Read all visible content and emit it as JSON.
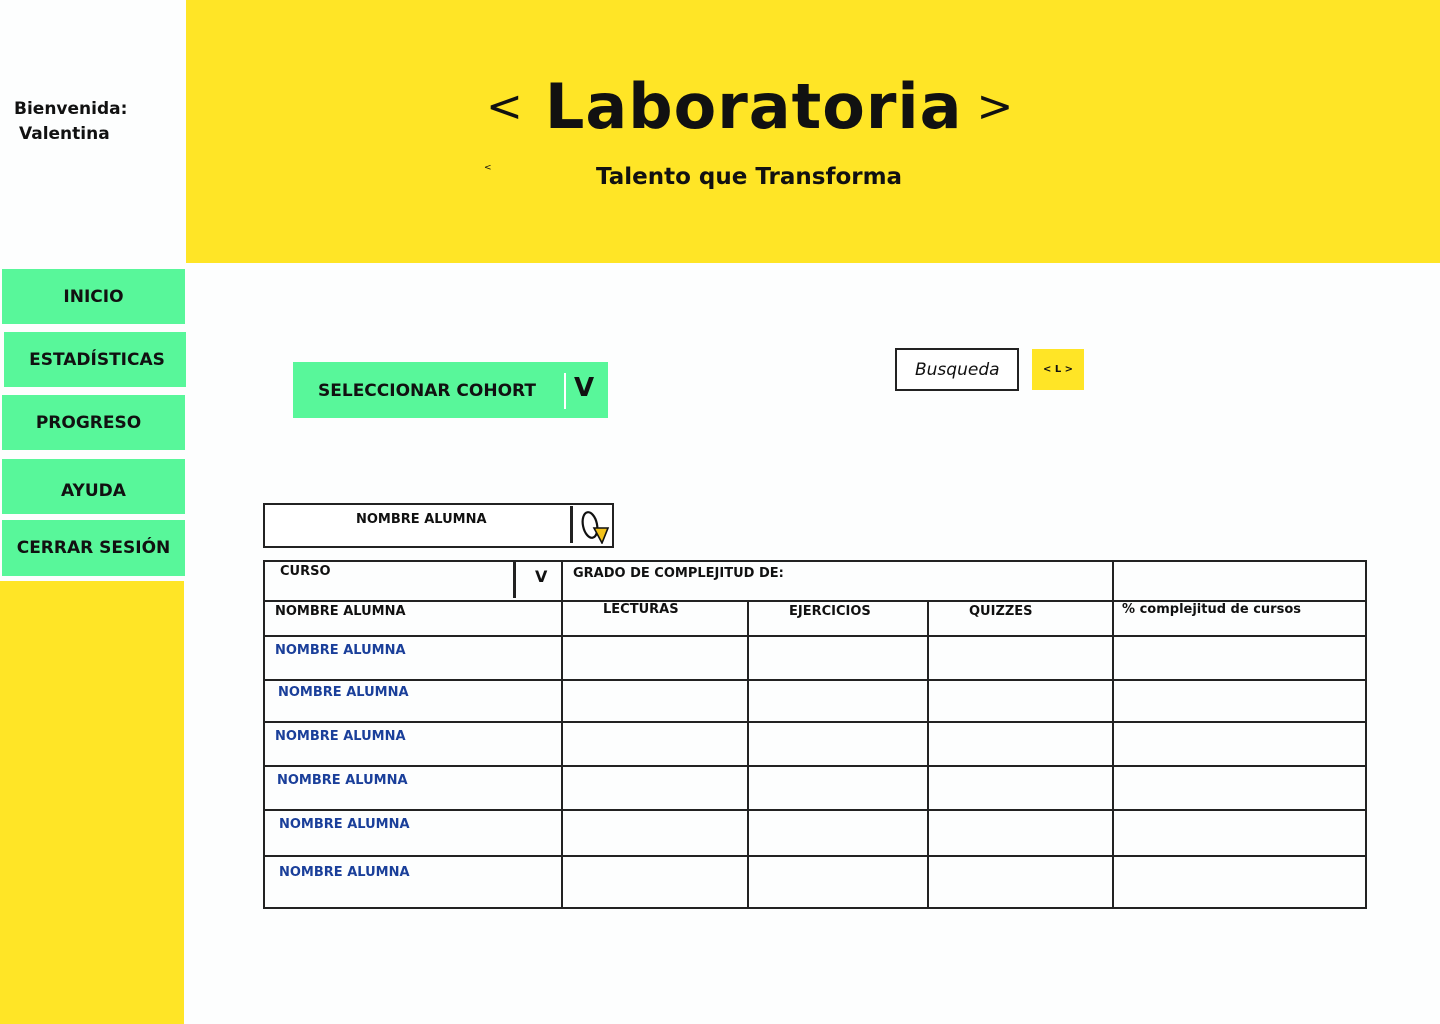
{
  "welcome": {
    "label": "Bienvenida:",
    "name": "Valentina"
  },
  "header": {
    "bracket_open": "<",
    "title": "Laboratoria",
    "bracket_close": ">",
    "tagline": "Talento que Transforma",
    "small_mark": "<"
  },
  "sidebar": {
    "items": [
      {
        "label": "INICIO"
      },
      {
        "label": "ESTADÍSTICAS"
      },
      {
        "label": "PROGRESO"
      },
      {
        "label": "AYUDA"
      },
      {
        "label": "CERRAR SESIÓN"
      }
    ]
  },
  "cohort": {
    "label": "SELECCIONAR COHORT",
    "chevron": "V"
  },
  "search": {
    "text": "Busqueda",
    "button": "< L >"
  },
  "name_search": {
    "label": "NOMBRE ALUMNA",
    "icon": "search-magnifier-icon"
  },
  "table": {
    "curso_label": "CURSO",
    "curso_chevron": "V",
    "grado_label": "GRADO DE COMPLEJITUD DE:",
    "columns": [
      "NOMBRE ALUMNA",
      "LECTURAS",
      "EJERCICIOS",
      "QUIZZES",
      "% complejitud de cursos"
    ],
    "rows": [
      "NOMBRE ALUMNA",
      "NOMBRE ALUMNA",
      "NOMBRE ALUMNA",
      "NOMBRE ALUMNA",
      "NOMBRE ALUMNA",
      "NOMBRE ALUMNA"
    ]
  },
  "colors": {
    "yellow": "#ffe526",
    "green": "#58f79a",
    "name_blue": "#1a3f9a"
  }
}
